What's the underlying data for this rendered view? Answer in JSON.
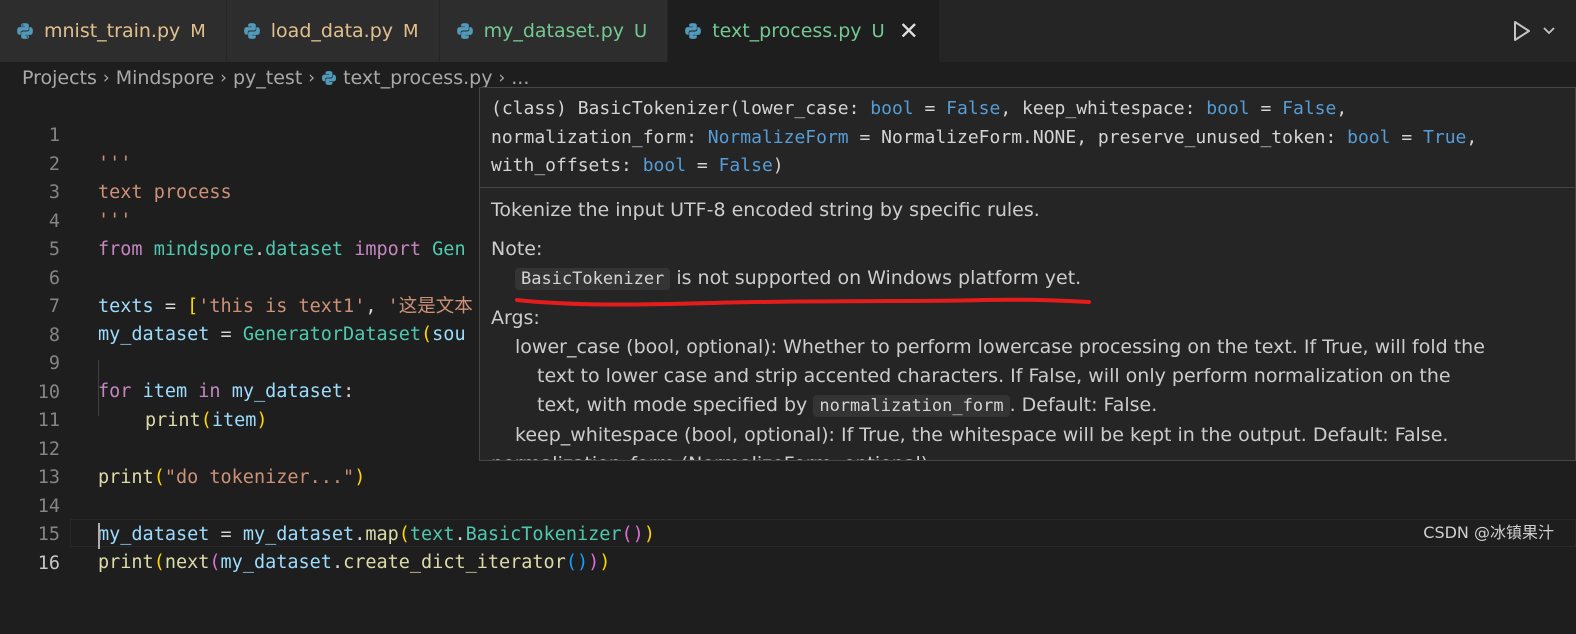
{
  "tabs": [
    {
      "name": "mnist_train.py",
      "badge": "M",
      "status": "modified"
    },
    {
      "name": "load_data.py",
      "badge": "M",
      "status": "modified"
    },
    {
      "name": "my_dataset.py",
      "badge": "U",
      "status": "untracked"
    },
    {
      "name": "text_process.py",
      "badge": "U",
      "status": "untracked",
      "active": true,
      "close": "✕"
    }
  ],
  "toolbar": {
    "run_icon": "play-icon",
    "run_chevron": "chevron-down-icon"
  },
  "breadcrumb": {
    "items": [
      "Projects",
      "Mindspore",
      "py_test",
      "text_process.py",
      "..."
    ]
  },
  "editor": {
    "line_numbers": [
      "1",
      "2",
      "3",
      "4",
      "5",
      "6",
      "7",
      "8",
      "9",
      "10",
      "11",
      "12",
      "13",
      "14",
      "15",
      "16"
    ],
    "l1": "'''",
    "l2": "text process",
    "l3": "'''",
    "l4": {
      "from": "from",
      "module": "mindspore",
      "dot": ".",
      "sub": "dataset",
      "import": "import",
      "tail": "Gen"
    },
    "l6": {
      "var": "texts",
      "eq": " = ",
      "br": "[",
      "s1": "'this is text1'",
      "comma": ", ",
      "s2": "'这是文本"
    },
    "l7": {
      "var": "my_dataset",
      "eq": " = ",
      "cls": "GeneratorDataset",
      "p": "(",
      "tail": "sou"
    },
    "l9": {
      "for": "for",
      "item": "item",
      "in": "in",
      "ds": "my_dataset",
      "colon": ":"
    },
    "l10": {
      "fn": "print",
      "p": "(",
      "arg": "item",
      "pc": ")"
    },
    "l12": {
      "fn": "print",
      "p": "(",
      "s": "\"do tokenizer...\"",
      "pc": ")"
    },
    "l14": {
      "var": "my_dataset",
      "eq": " = ",
      "ds": "my_dataset",
      "dot": ".",
      "map": "map",
      "p": "(",
      "mod": "text",
      "dot2": ".",
      "cls": "BasicTokenizer",
      "pp": "()",
      "pc": ")"
    },
    "l15": {
      "fn": "print",
      "p": "(",
      "next": "next",
      "p2": "(",
      "ds": "my_dataset",
      "dot": ".",
      "meth": "create_dict_iterator",
      "p3": "()",
      "pc2": ")",
      "pc": ")"
    }
  },
  "hover": {
    "sig1": {
      "a": "(class) BasicTokenizer(lower_case: ",
      "b": "bool",
      "c": " = ",
      "d": "False",
      "e": ", keep_whitespace: ",
      "f": "bool",
      "g": " = ",
      "h": "False",
      "i": ","
    },
    "sig2": {
      "a": "normalization_form: ",
      "b": "NormalizeForm",
      "c": " = NormalizeForm.NONE, preserve_unused_token: ",
      "d": "bool",
      "e": " = ",
      "f": "True",
      "g": ","
    },
    "sig3": {
      "a": "with_offsets: ",
      "b": "bool",
      "c": " = ",
      "d": "False",
      "e": ")"
    },
    "summary": "Tokenize the input UTF-8 encoded string by specific rules.",
    "note_label": "Note:",
    "note_code": "BasicTokenizer",
    "note_text": " is not supported on Windows platform yet.",
    "args_label": "Args:",
    "arg1_a": "lower_case (bool, optional): Whether to perform lowercase processing on the text. If True, will fold the",
    "arg1_b": "text to lower case and strip accented characters. If False, will only perform normalization on the",
    "arg1_c_pre": "text, with mode specified by ",
    "arg1_c_code": "normalization_form",
    "arg1_c_post": ". Default: False.",
    "arg2": "keep_whitespace (bool, optional): If True, the whitespace will be kept in the output. Default: False.",
    "arg3": "normalization_form (NormalizeForm, optional):"
  },
  "watermark": "CSDN @冰镇果汁",
  "colors": {
    "background": "#1e1e1e",
    "tabbar": "#252526",
    "modified": "#e2c08d",
    "untracked": "#73c991",
    "annotation": "#e51c1c"
  }
}
